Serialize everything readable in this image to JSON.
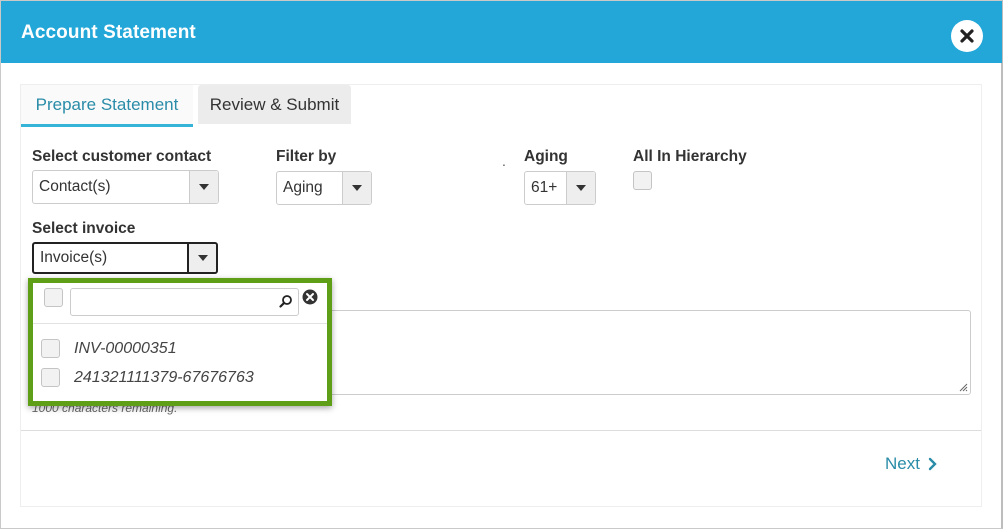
{
  "header": {
    "title": "Account Statement",
    "close_icon": "close-icon"
  },
  "tabs": [
    {
      "label": "Prepare Statement",
      "active": true
    },
    {
      "label": "Review & Submit",
      "active": false
    }
  ],
  "form": {
    "customer_contact": {
      "label": "Select customer contact",
      "value": "Contact(s)"
    },
    "filter_by": {
      "label": "Filter by",
      "value": "Aging"
    },
    "separator": ".",
    "aging": {
      "label": "Aging",
      "value": "61+"
    },
    "all_in_hierarchy": {
      "label": "All In Hierarchy",
      "checked": false
    },
    "invoice": {
      "label": "Select invoice",
      "value": "Invoice(s)"
    }
  },
  "invoice_dropdown": {
    "search_value": "",
    "search_placeholder": "",
    "items": [
      {
        "label": "INV-00000351",
        "checked": false
      },
      {
        "label": "241321111379-67676763",
        "checked": false
      }
    ]
  },
  "notes": {
    "chars_remaining": "1000 characters remaining."
  },
  "footer": {
    "next_label": "Next"
  },
  "colors": {
    "header": "#22a7d8",
    "accent": "#2a8ca8",
    "highlight": "#5f9e17"
  }
}
